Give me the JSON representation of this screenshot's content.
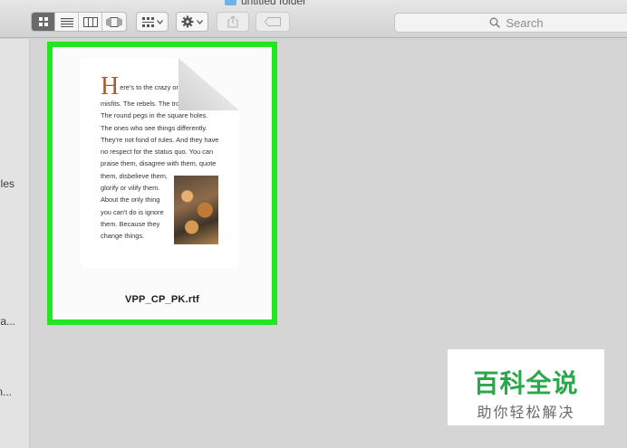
{
  "window": {
    "title": "untitled folder"
  },
  "toolbar": {
    "view_buttons": [
      {
        "name": "icon-view",
        "icon": "grid-icon",
        "active": true
      },
      {
        "name": "list-view",
        "icon": "list-icon",
        "active": false
      },
      {
        "name": "column-view",
        "icon": "columns-icon",
        "active": false
      },
      {
        "name": "gallery-view",
        "icon": "coverflow-icon",
        "active": false
      }
    ],
    "arrange_icon": "arrange-grid-icon",
    "action_icon": "gear-icon",
    "share_icon": "share-icon",
    "tag_icon": "tag-icon",
    "search_placeholder": "Search"
  },
  "sidebar": {
    "items": [
      "les",
      "va...",
      "n..."
    ]
  },
  "file": {
    "name": "VPP_CP_PK.rtf",
    "preview": {
      "drop_cap": "H",
      "lines": [
        "ere's to the crazy ones",
        "misfits. The rebels. The trou",
        "The round pegs in the square holes.",
        "The ones who see things differently.",
        "They're not fond of rules. And they have",
        "no respect for the status quo. You can",
        "praise them, disagree with them, quote",
        "them, disbelieve them,",
        "glorify or vilify them.",
        "About the only thing",
        "you can't do is ignore",
        "them. Because they",
        "change things."
      ]
    }
  },
  "watermark": {
    "title": "百科全说",
    "subtitle": "助你轻松解决"
  },
  "colors": {
    "highlight": "#22e622",
    "watermark_green": "#2aa84a"
  }
}
